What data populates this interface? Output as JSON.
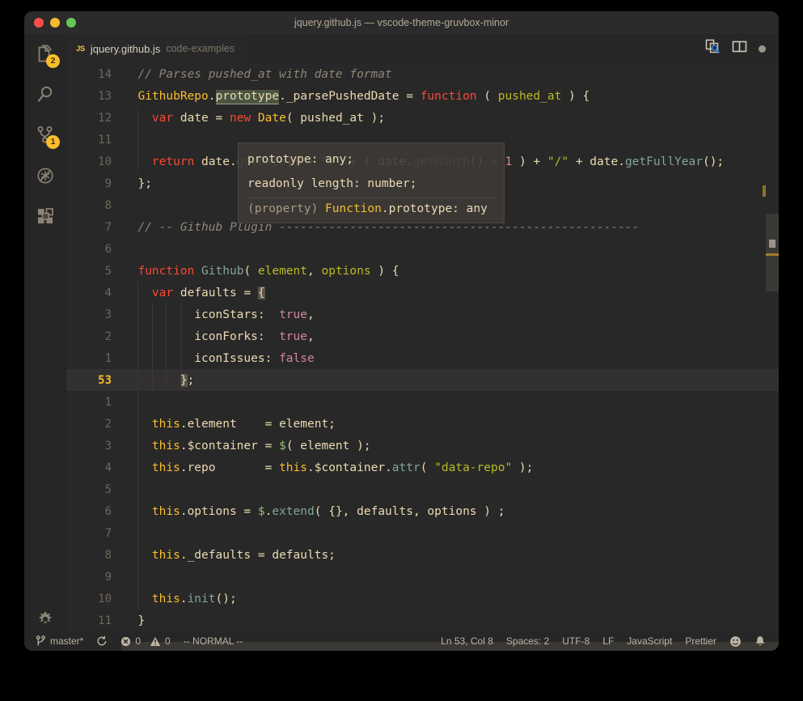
{
  "window": {
    "title": "jquery.github.js — vscode-theme-gruvbox-minor",
    "traffic_lights": [
      "close-red",
      "minimize-yellow",
      "maximize-green"
    ]
  },
  "activity_bar": {
    "items": [
      {
        "name": "explorer",
        "icon": "files-icon",
        "badge": "2"
      },
      {
        "name": "search",
        "icon": "search-icon",
        "badge": ""
      },
      {
        "name": "source-control",
        "icon": "source-control-icon",
        "badge": "1"
      },
      {
        "name": "run-and-debug",
        "icon": "debug-disabled-icon",
        "badge": ""
      },
      {
        "name": "extensions",
        "icon": "extensions-icon",
        "badge": ""
      }
    ],
    "manage": {
      "name": "manage-settings",
      "icon": "gear-icon"
    }
  },
  "tab": {
    "file_icon": "JS",
    "label": "jquery.github.js",
    "description": "code-examples",
    "actions": [
      {
        "name": "open-changes",
        "icon": "compare-search-icon"
      },
      {
        "name": "split-editor",
        "icon": "split-editor-icon"
      },
      {
        "name": "unsaved-indicator",
        "icon": "dirty-dot-icon"
      }
    ]
  },
  "editor": {
    "current_line_number": "53",
    "occurrence_token": "prototype",
    "lines": [
      {
        "num": "14",
        "current": false,
        "guides": 0,
        "segs": [
          {
            "t": "  // Parses pushed_at with date format",
            "c": "c-comment"
          }
        ]
      },
      {
        "num": "13",
        "current": false,
        "guides": 0,
        "segs": [
          {
            "t": "  ",
            "c": "c-plain"
          },
          {
            "t": "GithubRepo",
            "c": "c-type"
          },
          {
            "t": ".",
            "c": "c-punct"
          },
          {
            "t": "prototype",
            "c": "c-prop",
            "occ": true
          },
          {
            "t": "._parsePushedDate ",
            "c": "c-plain"
          },
          {
            "t": "= ",
            "c": "c-punct"
          },
          {
            "t": "function",
            "c": "c-kw"
          },
          {
            "t": " ( ",
            "c": "c-punct"
          },
          {
            "t": "pushed_at",
            "c": "c-param"
          },
          {
            "t": " ) {",
            "c": "c-punct"
          }
        ]
      },
      {
        "num": "12",
        "current": false,
        "guides": 1,
        "segs": [
          {
            "t": "    ",
            "c": "c-plain"
          },
          {
            "t": "var",
            "c": "c-kw"
          },
          {
            "t": " date ",
            "c": "c-plain"
          },
          {
            "t": "= ",
            "c": "c-punct"
          },
          {
            "t": "new",
            "c": "c-kw"
          },
          {
            "t": " ",
            "c": "c-plain"
          },
          {
            "t": "Date",
            "c": "c-type"
          },
          {
            "t": "( pushed_at );",
            "c": "c-punct"
          }
        ]
      },
      {
        "num": "11",
        "current": false,
        "guides": 1,
        "segs": [
          {
            "t": "",
            "c": "c-plain"
          }
        ]
      },
      {
        "num": "10",
        "current": false,
        "guides": 1,
        "segs": [
          {
            "t": "    ",
            "c": "c-plain"
          },
          {
            "t": "return",
            "c": "c-kw"
          },
          {
            "t": " date",
            "c": "c-plain"
          },
          {
            "t": ".",
            "c": "c-punct"
          },
          {
            "t": "getDate",
            "c": "c-method"
          },
          {
            "t": "() ",
            "c": "c-punct"
          },
          {
            "t": "+ ",
            "c": "c-punct"
          },
          {
            "t": "\"/\"",
            "c": "c-str"
          },
          {
            "t": " + ( date",
            "c": "c-plain"
          },
          {
            "t": ".",
            "c": "c-punct"
          },
          {
            "t": "getMonth",
            "c": "c-method"
          },
          {
            "t": "() + ",
            "c": "c-punct"
          },
          {
            "t": "1",
            "c": "c-num"
          },
          {
            "t": " ) + ",
            "c": "c-punct"
          },
          {
            "t": "\"/\"",
            "c": "c-str"
          },
          {
            "t": " + date",
            "c": "c-plain"
          },
          {
            "t": ".",
            "c": "c-punct"
          },
          {
            "t": "getFullYear",
            "c": "c-method"
          },
          {
            "t": "();",
            "c": "c-punct"
          }
        ]
      },
      {
        "num": "9",
        "current": false,
        "guides": 0,
        "segs": [
          {
            "t": "  };",
            "c": "c-punct"
          }
        ]
      },
      {
        "num": "8",
        "current": false,
        "guides": 0,
        "segs": [
          {
            "t": "",
            "c": "c-plain"
          }
        ]
      },
      {
        "num": "7",
        "current": false,
        "guides": 0,
        "segs": [
          {
            "t": "  // -- Github Plugin ---------------------------------------------------",
            "c": "c-comment"
          }
        ]
      },
      {
        "num": "6",
        "current": false,
        "guides": 0,
        "segs": [
          {
            "t": "",
            "c": "c-plain"
          }
        ]
      },
      {
        "num": "5",
        "current": false,
        "guides": 0,
        "segs": [
          {
            "t": "  ",
            "c": "c-plain"
          },
          {
            "t": "function",
            "c": "c-kw"
          },
          {
            "t": " ",
            "c": "c-plain"
          },
          {
            "t": "Github",
            "c": "c-method"
          },
          {
            "t": "( ",
            "c": "c-punct"
          },
          {
            "t": "element",
            "c": "c-param"
          },
          {
            "t": ", ",
            "c": "c-punct"
          },
          {
            "t": "options",
            "c": "c-param"
          },
          {
            "t": " ) {",
            "c": "c-punct"
          }
        ]
      },
      {
        "num": "4",
        "current": false,
        "guides": 1,
        "segs": [
          {
            "t": "    ",
            "c": "c-plain"
          },
          {
            "t": "var",
            "c": "c-kw"
          },
          {
            "t": " defaults ",
            "c": "c-plain"
          },
          {
            "t": "= ",
            "c": "c-punct"
          },
          {
            "t": "{",
            "c": "c-punct",
            "bracket": true
          }
        ]
      },
      {
        "num": "3",
        "current": false,
        "guides": 4,
        "segs": [
          {
            "t": "          iconStars:  ",
            "c": "c-prop"
          },
          {
            "t": "true",
            "c": "c-bool"
          },
          {
            "t": ",",
            "c": "c-punct"
          }
        ]
      },
      {
        "num": "2",
        "current": false,
        "guides": 4,
        "segs": [
          {
            "t": "          iconForks:  ",
            "c": "c-prop"
          },
          {
            "t": "true",
            "c": "c-bool"
          },
          {
            "t": ",",
            "c": "c-punct"
          }
        ]
      },
      {
        "num": "1",
        "current": false,
        "guides": 4,
        "segs": [
          {
            "t": "          iconIssues: ",
            "c": "c-prop"
          },
          {
            "t": "false",
            "c": "c-bool"
          }
        ]
      },
      {
        "num": "53",
        "current": true,
        "guides": 4,
        "segs": [
          {
            "t": "        ",
            "c": "c-plain"
          },
          {
            "t": "}",
            "c": "c-punct",
            "bracket": true
          },
          {
            "t": ";",
            "c": "c-punct"
          }
        ]
      },
      {
        "num": "1",
        "current": false,
        "guides": 1,
        "segs": [
          {
            "t": "",
            "c": "c-plain"
          }
        ]
      },
      {
        "num": "2",
        "current": false,
        "guides": 1,
        "segs": [
          {
            "t": "    ",
            "c": "c-plain"
          },
          {
            "t": "this",
            "c": "c-this"
          },
          {
            "t": ".element    ",
            "c": "c-plain"
          },
          {
            "t": "= ",
            "c": "c-punct"
          },
          {
            "t": "element;",
            "c": "c-plain"
          }
        ]
      },
      {
        "num": "3",
        "current": false,
        "guides": 1,
        "segs": [
          {
            "t": "    ",
            "c": "c-plain"
          },
          {
            "t": "this",
            "c": "c-this"
          },
          {
            "t": ".$container ",
            "c": "c-plain"
          },
          {
            "t": "= ",
            "c": "c-punct"
          },
          {
            "t": "$",
            "c": "c-dollar"
          },
          {
            "t": "( element );",
            "c": "c-punct"
          }
        ]
      },
      {
        "num": "4",
        "current": false,
        "guides": 1,
        "segs": [
          {
            "t": "    ",
            "c": "c-plain"
          },
          {
            "t": "this",
            "c": "c-this"
          },
          {
            "t": ".repo       ",
            "c": "c-plain"
          },
          {
            "t": "= ",
            "c": "c-punct"
          },
          {
            "t": "this",
            "c": "c-this"
          },
          {
            "t": ".$container",
            "c": "c-plain"
          },
          {
            "t": ".",
            "c": "c-punct"
          },
          {
            "t": "attr",
            "c": "c-method"
          },
          {
            "t": "( ",
            "c": "c-punct"
          },
          {
            "t": "\"data-repo\"",
            "c": "c-str"
          },
          {
            "t": " );",
            "c": "c-punct"
          }
        ]
      },
      {
        "num": "5",
        "current": false,
        "guides": 1,
        "segs": [
          {
            "t": "",
            "c": "c-plain"
          }
        ]
      },
      {
        "num": "6",
        "current": false,
        "guides": 1,
        "segs": [
          {
            "t": "    ",
            "c": "c-plain"
          },
          {
            "t": "this",
            "c": "c-this"
          },
          {
            "t": ".options ",
            "c": "c-plain"
          },
          {
            "t": "= ",
            "c": "c-punct"
          },
          {
            "t": "$",
            "c": "c-dollar"
          },
          {
            "t": ".",
            "c": "c-punct"
          },
          {
            "t": "extend",
            "c": "c-method"
          },
          {
            "t": "( {}, defaults, options ) ;",
            "c": "c-punct"
          }
        ]
      },
      {
        "num": "7",
        "current": false,
        "guides": 1,
        "segs": [
          {
            "t": "",
            "c": "c-plain"
          }
        ]
      },
      {
        "num": "8",
        "current": false,
        "guides": 1,
        "segs": [
          {
            "t": "    ",
            "c": "c-plain"
          },
          {
            "t": "this",
            "c": "c-this"
          },
          {
            "t": "._defaults ",
            "c": "c-plain"
          },
          {
            "t": "= ",
            "c": "c-punct"
          },
          {
            "t": "defaults;",
            "c": "c-plain"
          }
        ]
      },
      {
        "num": "9",
        "current": false,
        "guides": 1,
        "segs": [
          {
            "t": "",
            "c": "c-plain"
          }
        ]
      },
      {
        "num": "10",
        "current": false,
        "guides": 1,
        "segs": [
          {
            "t": "    ",
            "c": "c-plain"
          },
          {
            "t": "this",
            "c": "c-this"
          },
          {
            "t": ".",
            "c": "c-punct"
          },
          {
            "t": "init",
            "c": "c-method"
          },
          {
            "t": "();",
            "c": "c-punct"
          }
        ]
      },
      {
        "num": "11",
        "current": false,
        "guides": 0,
        "segs": [
          {
            "t": "  }",
            "c": "c-punct"
          }
        ]
      }
    ]
  },
  "hover": {
    "rows": [
      "prototype: any;",
      "readonly length: number;"
    ],
    "signature_prefix": "(property) ",
    "signature_type": "Function",
    "signature_suffix": ".prototype: any"
  },
  "status_bar": {
    "left": [
      {
        "name": "branch",
        "icon": "git-branch-icon",
        "label": "master*"
      },
      {
        "name": "sync",
        "icon": "sync-icon",
        "label": ""
      },
      {
        "name": "problems-errors",
        "icon": "error-icon",
        "label": "0"
      },
      {
        "name": "problems-warnings",
        "icon": "warning-icon",
        "label": "0"
      },
      {
        "name": "vim-mode",
        "icon": "",
        "label": "-- NORMAL --"
      }
    ],
    "right": [
      {
        "name": "cursor-position",
        "icon": "",
        "label": "Ln 53, Col 8"
      },
      {
        "name": "indentation",
        "icon": "",
        "label": "Spaces: 2"
      },
      {
        "name": "encoding",
        "icon": "",
        "label": "UTF-8"
      },
      {
        "name": "eol",
        "icon": "",
        "label": "LF"
      },
      {
        "name": "language-mode",
        "icon": "",
        "label": "JavaScript"
      },
      {
        "name": "formatter",
        "icon": "",
        "label": "Prettier"
      },
      {
        "name": "feedback",
        "icon": "smiley-icon",
        "label": ""
      },
      {
        "name": "notifications",
        "icon": "bell-icon",
        "label": ""
      }
    ]
  },
  "colors": {
    "window_bg": "#282828",
    "chrome_bg": "#262626",
    "titlebar_bg": "#2b2b2b",
    "accent_badge": "#f9bd2b",
    "current_line_number": "#f8bb2d",
    "foreground": "#ebdbb2",
    "comment": "#8f8578",
    "keyword": "#fb4934",
    "string": "#b8bb26",
    "number": "#d3869b",
    "type": "#fabd2f",
    "method": "#83a598",
    "occurrence_highlight": "#4a5442"
  }
}
